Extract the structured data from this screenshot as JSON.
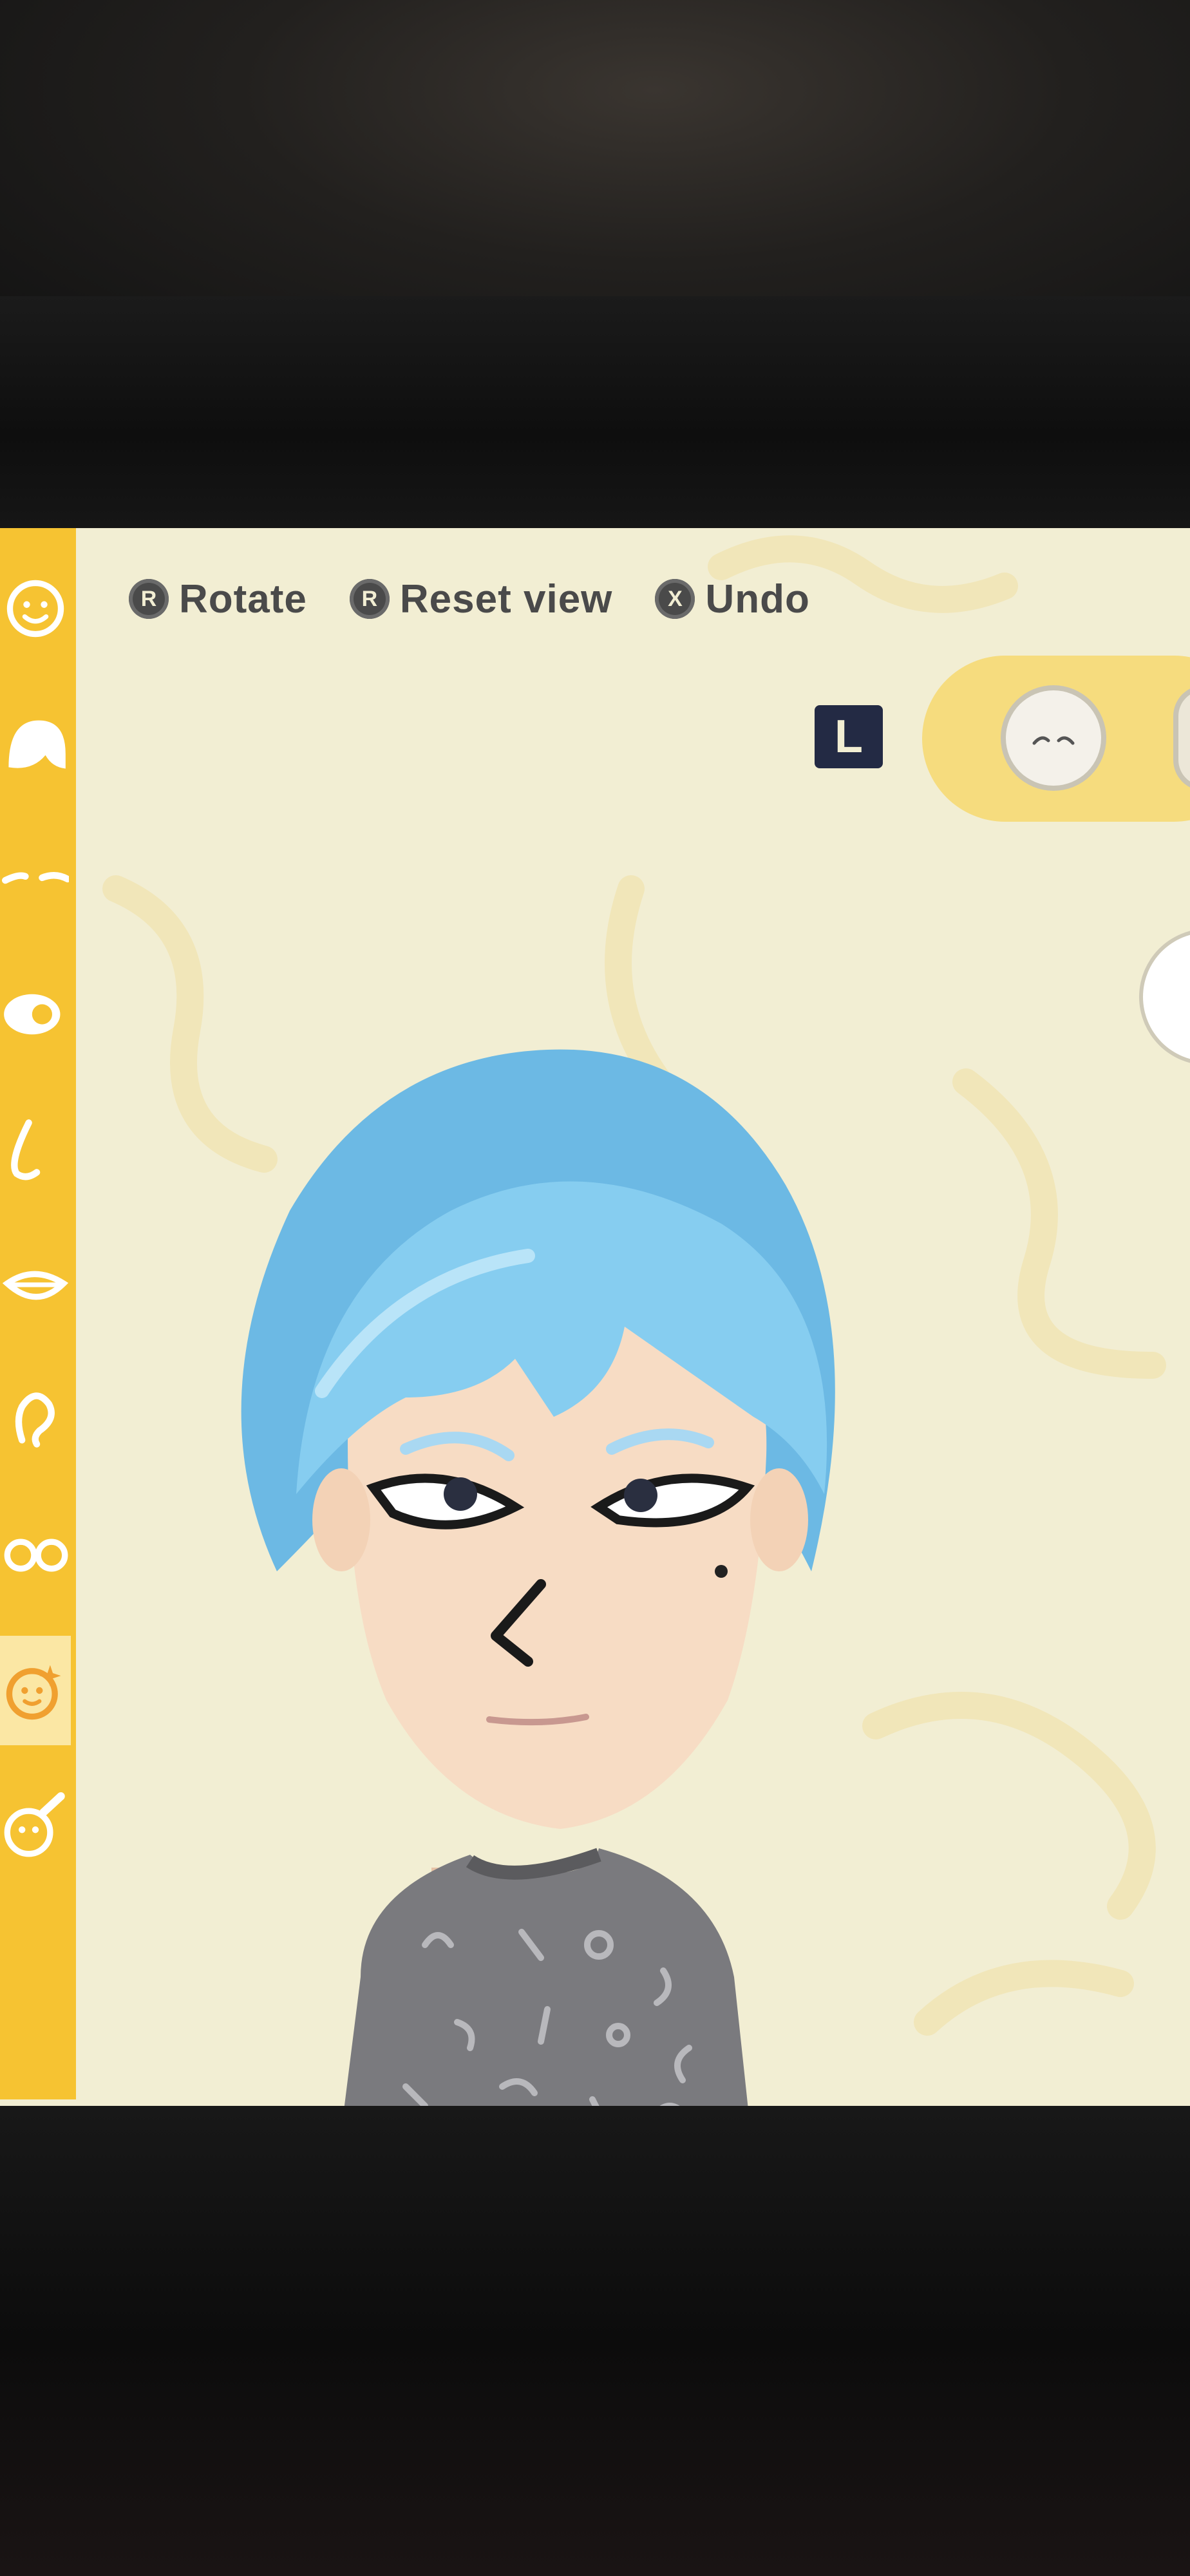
{
  "hints": [
    {
      "icon": "right-stick-icon",
      "button": "R",
      "label": "Rotate"
    },
    {
      "icon": "right-stick-press-icon",
      "button": "R",
      "label": "Reset view"
    },
    {
      "icon": "x-button-icon",
      "button": "X",
      "label": "Undo"
    }
  ],
  "tab_shoulder_button": "L",
  "sidebar_categories": [
    "face-category-icon",
    "hair-category-icon",
    "eyebrows-category-icon",
    "eyes-category-icon",
    "nose-category-icon",
    "mouth-category-icon",
    "ears-category-icon",
    "glasses-category-icon",
    "facial-features-category-icon",
    "makeup-category-icon"
  ],
  "colors": {
    "sidebar": "#f6c332",
    "background": "#f2eed3",
    "hair": "#7ec7ec",
    "skin": "#f7dcc4",
    "shirt": "#7a7a7e",
    "hint_text": "#4a4a4a"
  }
}
